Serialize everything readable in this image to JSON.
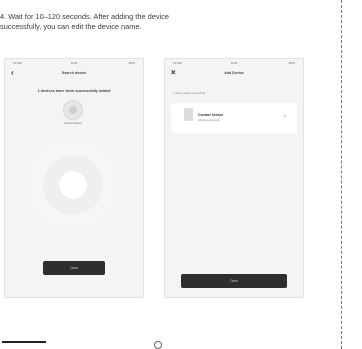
{
  "instruction": {
    "line1": "4. Wait for 10–120 seconds. After adding the device",
    "line2": "successfully, you can edit the device name."
  },
  "left_phone": {
    "status_bar": {
      "carrier": "No SIM",
      "time": "10:46",
      "battery": "100%"
    },
    "title": "Search device",
    "headline": "1 devices have been successfully added",
    "device_label": "Contact Sensor",
    "button_label": "Done"
  },
  "right_phone": {
    "status_bar": {
      "carrier": "No SIM",
      "time": "10:46",
      "battery": "100%"
    },
    "title": "Add Device",
    "sub_label": "1 device added successfully",
    "device_name": "Contact Sensor",
    "device_status": "Added successfully",
    "button_label": "Done"
  },
  "icons": {
    "back": "chevron-left-icon",
    "close": "close-icon",
    "edit": "pencil-icon"
  }
}
